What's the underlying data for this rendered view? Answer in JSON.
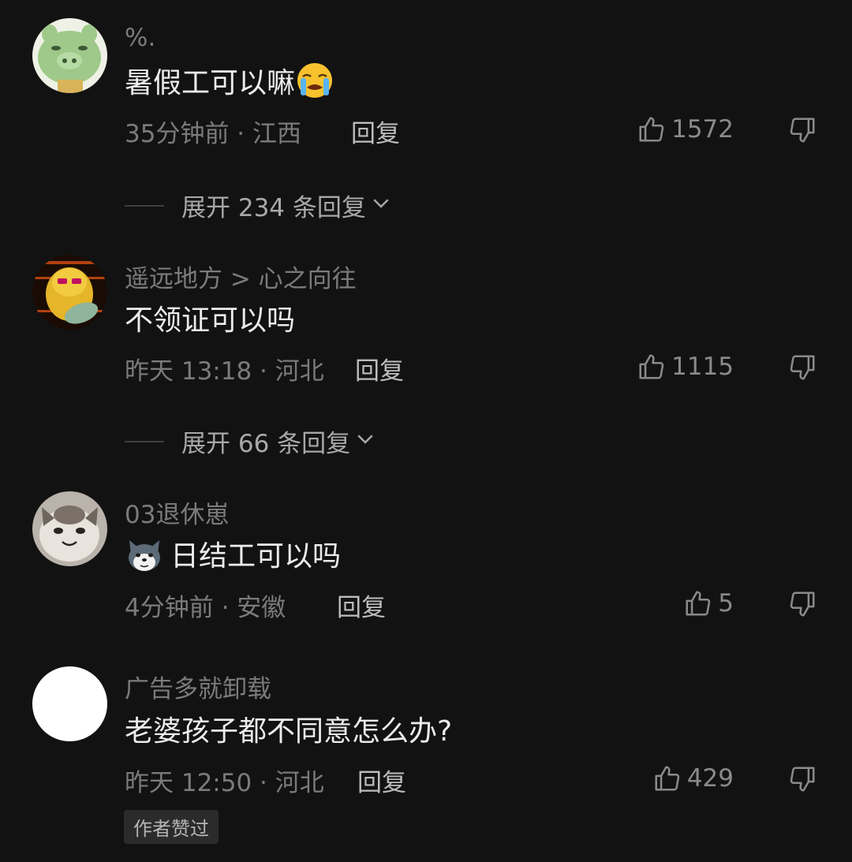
{
  "comments": [
    {
      "username": "%.",
      "text": "暑假工可以嘛",
      "emoji": "loudly-crying-face-emoji",
      "time": "35分钟前 · 江西",
      "reply_label": "回复",
      "likes": "1572",
      "expand_label": "展开 234 条回复"
    },
    {
      "username": "遥远地方 > 心之向往",
      "text": "不领证可以吗",
      "time": "昨天 13:18 · 河北",
      "reply_label": "回复",
      "likes": "1115",
      "expand_label": "展开 66 条回复"
    },
    {
      "username": "03退休崽",
      "text": "日结工可以吗",
      "emoji": "husky-face-emoji",
      "time": "4分钟前 · 安徽",
      "reply_label": "回复",
      "likes": "5"
    },
    {
      "username": "广告多就卸载",
      "text": "老婆孩子都不同意怎么办?",
      "time": "昨天 12:50 · 河北",
      "reply_label": "回复",
      "likes": "429",
      "badge": "作者赞过"
    }
  ],
  "icons": {
    "like": "thumbs-up-icon",
    "dislike": "thumbs-down-icon",
    "expand": "chevron-down-icon"
  },
  "colors": {
    "background": "#121212",
    "text_primary": "#ececec",
    "text_secondary": "#7b7b7b"
  }
}
